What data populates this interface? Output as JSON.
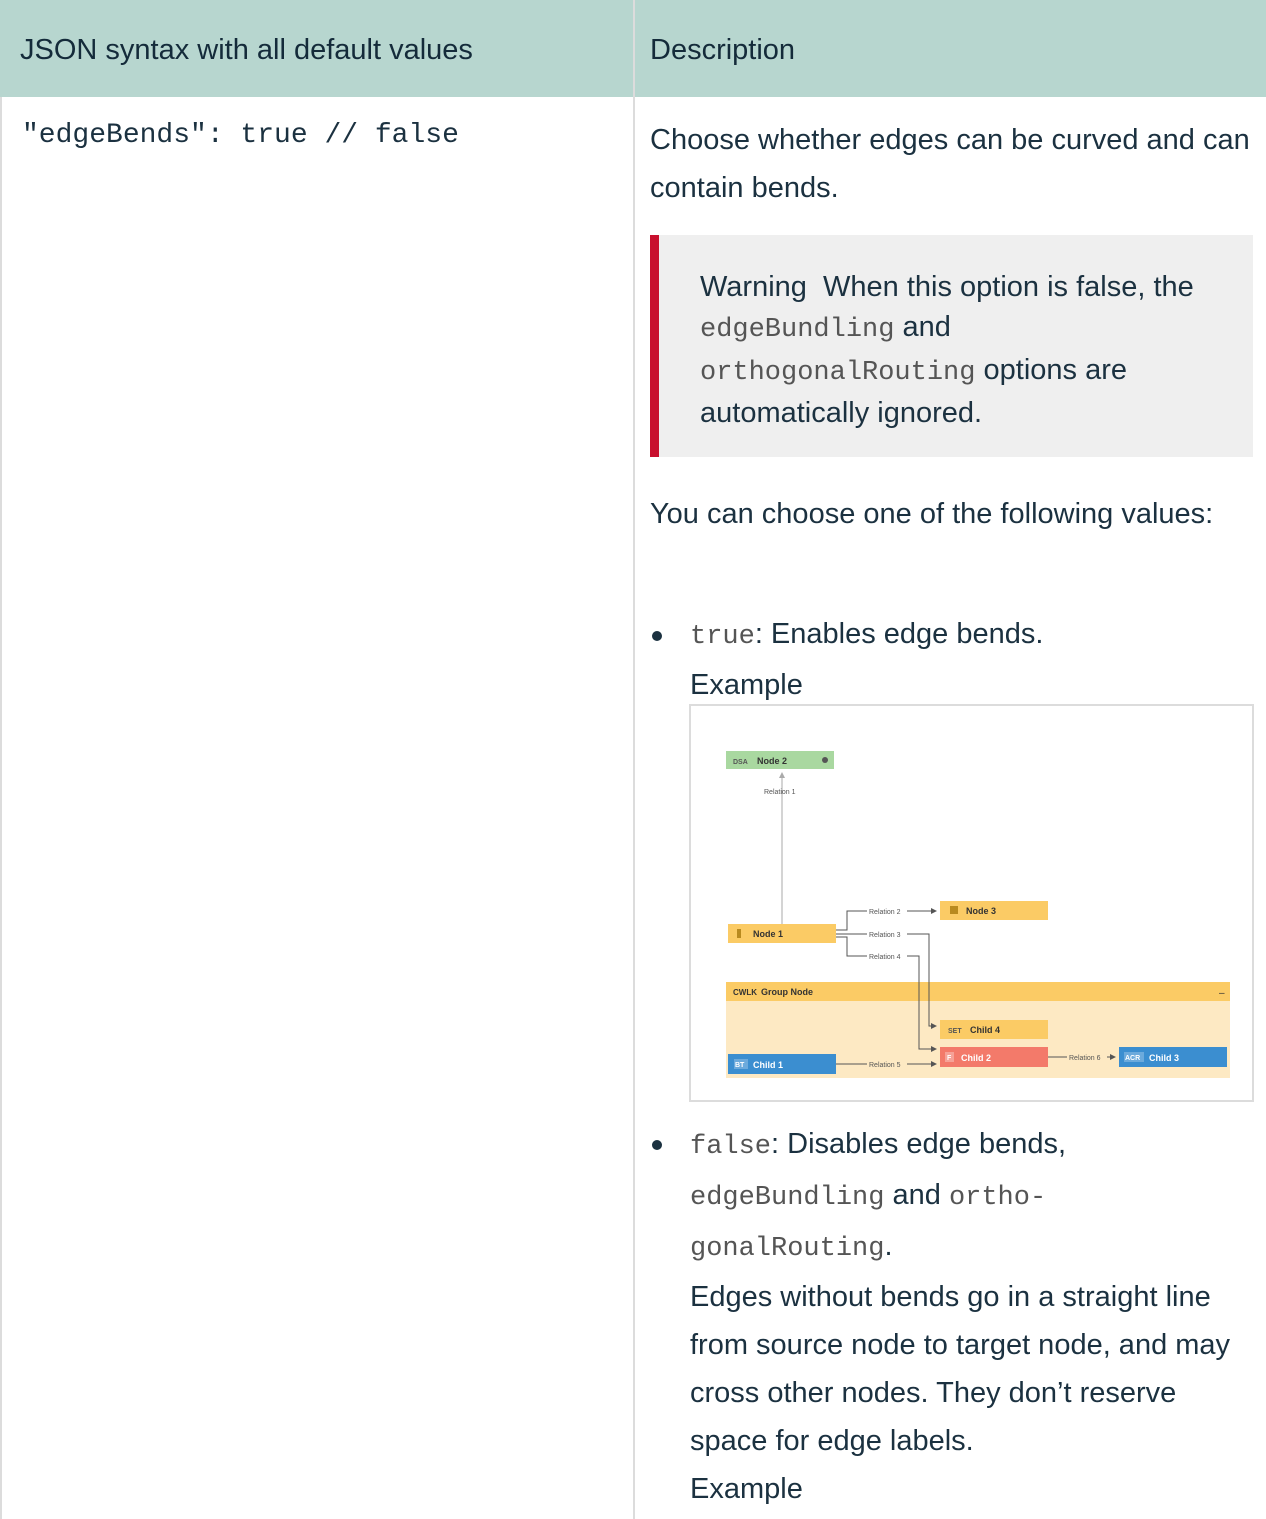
{
  "table": {
    "header_col1": "JSON syntax with all default values",
    "header_col2": "Description"
  },
  "row": {
    "code": "\"edgeBends\": true // false",
    "intro": "Choose whether edges can be curved and can contain bends.",
    "warning": {
      "label": "Warning",
      "text_1": "When this option is false, the",
      "code_1": "edgeBundling",
      "text_2": "and",
      "code_2": "orthogonalRouting",
      "text_3": "options are automatically ignored."
    },
    "choose": "You can choose one of the following values:",
    "items": [
      {
        "code": "true",
        "text": ": Enables edge bends.",
        "example": "Example"
      },
      {
        "code": "false",
        "text": ": Disables edge bends,",
        "code_2": "edgeBundling",
        "and": "and",
        "code_3a": "ortho-",
        "code_3b": "gonalRouting",
        "period": ".",
        "detail": "Edges without bends go in a straight line from source node to target node, and may cross other nodes. They don’t reserve space for edge labels.",
        "example": "Example"
      }
    ]
  },
  "diagram": {
    "nodes": {
      "node2": {
        "tag": "DSA",
        "label": "Node 2"
      },
      "node1": {
        "tag": "",
        "label": "Node 1"
      },
      "node3": {
        "tag": "",
        "label": "Node 3"
      },
      "group": {
        "tag": "CWLK",
        "label": "Group Node",
        "collapse": "–"
      },
      "child4": {
        "tag": "SET",
        "label": "Child 4"
      },
      "child1": {
        "tag": "BT",
        "label": "Child 1"
      },
      "child2": {
        "tag": "F",
        "label": "Child 2"
      },
      "child3": {
        "tag": "ACR",
        "label": "Child 3"
      }
    },
    "relations": [
      "Relation 1",
      "Relation 2",
      "Relation 3",
      "Relation 4",
      "Relation 5",
      "Relation 6"
    ]
  }
}
